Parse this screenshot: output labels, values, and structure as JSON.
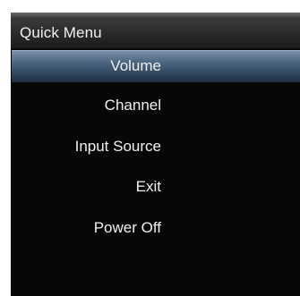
{
  "colors": {
    "osd_background": "#070707",
    "title_bar": "#2b2b2b",
    "selection_highlight": "#4f6884",
    "text": "#f0f0f0"
  },
  "menu": {
    "title": "Quick Menu",
    "selected": "Volume",
    "items": [
      {
        "label": "Volume"
      },
      {
        "label": "Channel"
      },
      {
        "label": "Input Source"
      },
      {
        "label": "Exit"
      },
      {
        "label": "Power Off"
      }
    ]
  }
}
